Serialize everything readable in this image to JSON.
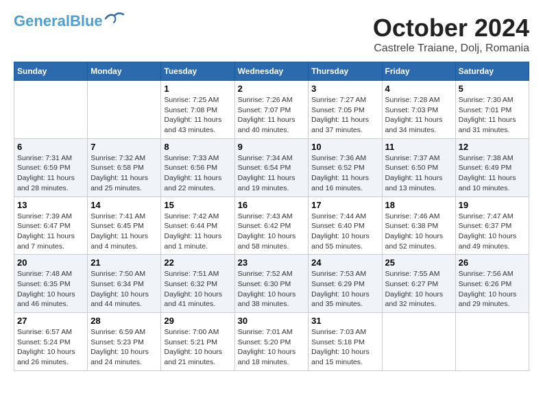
{
  "header": {
    "logo_line1": "General",
    "logo_line2": "Blue",
    "month": "October 2024",
    "location": "Castrele Traiane, Dolj, Romania"
  },
  "weekdays": [
    "Sunday",
    "Monday",
    "Tuesday",
    "Wednesday",
    "Thursday",
    "Friday",
    "Saturday"
  ],
  "weeks": [
    [
      {
        "day": "",
        "sunrise": "",
        "sunset": "",
        "daylight": ""
      },
      {
        "day": "",
        "sunrise": "",
        "sunset": "",
        "daylight": ""
      },
      {
        "day": "1",
        "sunrise": "Sunrise: 7:25 AM",
        "sunset": "Sunset: 7:08 PM",
        "daylight": "Daylight: 11 hours and 43 minutes."
      },
      {
        "day": "2",
        "sunrise": "Sunrise: 7:26 AM",
        "sunset": "Sunset: 7:07 PM",
        "daylight": "Daylight: 11 hours and 40 minutes."
      },
      {
        "day": "3",
        "sunrise": "Sunrise: 7:27 AM",
        "sunset": "Sunset: 7:05 PM",
        "daylight": "Daylight: 11 hours and 37 minutes."
      },
      {
        "day": "4",
        "sunrise": "Sunrise: 7:28 AM",
        "sunset": "Sunset: 7:03 PM",
        "daylight": "Daylight: 11 hours and 34 minutes."
      },
      {
        "day": "5",
        "sunrise": "Sunrise: 7:30 AM",
        "sunset": "Sunset: 7:01 PM",
        "daylight": "Daylight: 11 hours and 31 minutes."
      }
    ],
    [
      {
        "day": "6",
        "sunrise": "Sunrise: 7:31 AM",
        "sunset": "Sunset: 6:59 PM",
        "daylight": "Daylight: 11 hours and 28 minutes."
      },
      {
        "day": "7",
        "sunrise": "Sunrise: 7:32 AM",
        "sunset": "Sunset: 6:58 PM",
        "daylight": "Daylight: 11 hours and 25 minutes."
      },
      {
        "day": "8",
        "sunrise": "Sunrise: 7:33 AM",
        "sunset": "Sunset: 6:56 PM",
        "daylight": "Daylight: 11 hours and 22 minutes."
      },
      {
        "day": "9",
        "sunrise": "Sunrise: 7:34 AM",
        "sunset": "Sunset: 6:54 PM",
        "daylight": "Daylight: 11 hours and 19 minutes."
      },
      {
        "day": "10",
        "sunrise": "Sunrise: 7:36 AM",
        "sunset": "Sunset: 6:52 PM",
        "daylight": "Daylight: 11 hours and 16 minutes."
      },
      {
        "day": "11",
        "sunrise": "Sunrise: 7:37 AM",
        "sunset": "Sunset: 6:50 PM",
        "daylight": "Daylight: 11 hours and 13 minutes."
      },
      {
        "day": "12",
        "sunrise": "Sunrise: 7:38 AM",
        "sunset": "Sunset: 6:49 PM",
        "daylight": "Daylight: 11 hours and 10 minutes."
      }
    ],
    [
      {
        "day": "13",
        "sunrise": "Sunrise: 7:39 AM",
        "sunset": "Sunset: 6:47 PM",
        "daylight": "Daylight: 11 hours and 7 minutes."
      },
      {
        "day": "14",
        "sunrise": "Sunrise: 7:41 AM",
        "sunset": "Sunset: 6:45 PM",
        "daylight": "Daylight: 11 hours and 4 minutes."
      },
      {
        "day": "15",
        "sunrise": "Sunrise: 7:42 AM",
        "sunset": "Sunset: 6:44 PM",
        "daylight": "Daylight: 11 hours and 1 minute."
      },
      {
        "day": "16",
        "sunrise": "Sunrise: 7:43 AM",
        "sunset": "Sunset: 6:42 PM",
        "daylight": "Daylight: 10 hours and 58 minutes."
      },
      {
        "day": "17",
        "sunrise": "Sunrise: 7:44 AM",
        "sunset": "Sunset: 6:40 PM",
        "daylight": "Daylight: 10 hours and 55 minutes."
      },
      {
        "day": "18",
        "sunrise": "Sunrise: 7:46 AM",
        "sunset": "Sunset: 6:38 PM",
        "daylight": "Daylight: 10 hours and 52 minutes."
      },
      {
        "day": "19",
        "sunrise": "Sunrise: 7:47 AM",
        "sunset": "Sunset: 6:37 PM",
        "daylight": "Daylight: 10 hours and 49 minutes."
      }
    ],
    [
      {
        "day": "20",
        "sunrise": "Sunrise: 7:48 AM",
        "sunset": "Sunset: 6:35 PM",
        "daylight": "Daylight: 10 hours and 46 minutes."
      },
      {
        "day": "21",
        "sunrise": "Sunrise: 7:50 AM",
        "sunset": "Sunset: 6:34 PM",
        "daylight": "Daylight: 10 hours and 44 minutes."
      },
      {
        "day": "22",
        "sunrise": "Sunrise: 7:51 AM",
        "sunset": "Sunset: 6:32 PM",
        "daylight": "Daylight: 10 hours and 41 minutes."
      },
      {
        "day": "23",
        "sunrise": "Sunrise: 7:52 AM",
        "sunset": "Sunset: 6:30 PM",
        "daylight": "Daylight: 10 hours and 38 minutes."
      },
      {
        "day": "24",
        "sunrise": "Sunrise: 7:53 AM",
        "sunset": "Sunset: 6:29 PM",
        "daylight": "Daylight: 10 hours and 35 minutes."
      },
      {
        "day": "25",
        "sunrise": "Sunrise: 7:55 AM",
        "sunset": "Sunset: 6:27 PM",
        "daylight": "Daylight: 10 hours and 32 minutes."
      },
      {
        "day": "26",
        "sunrise": "Sunrise: 7:56 AM",
        "sunset": "Sunset: 6:26 PM",
        "daylight": "Daylight: 10 hours and 29 minutes."
      }
    ],
    [
      {
        "day": "27",
        "sunrise": "Sunrise: 6:57 AM",
        "sunset": "Sunset: 5:24 PM",
        "daylight": "Daylight: 10 hours and 26 minutes."
      },
      {
        "day": "28",
        "sunrise": "Sunrise: 6:59 AM",
        "sunset": "Sunset: 5:23 PM",
        "daylight": "Daylight: 10 hours and 24 minutes."
      },
      {
        "day": "29",
        "sunrise": "Sunrise: 7:00 AM",
        "sunset": "Sunset: 5:21 PM",
        "daylight": "Daylight: 10 hours and 21 minutes."
      },
      {
        "day": "30",
        "sunrise": "Sunrise: 7:01 AM",
        "sunset": "Sunset: 5:20 PM",
        "daylight": "Daylight: 10 hours and 18 minutes."
      },
      {
        "day": "31",
        "sunrise": "Sunrise: 7:03 AM",
        "sunset": "Sunset: 5:18 PM",
        "daylight": "Daylight: 10 hours and 15 minutes."
      },
      {
        "day": "",
        "sunrise": "",
        "sunset": "",
        "daylight": ""
      },
      {
        "day": "",
        "sunrise": "",
        "sunset": "",
        "daylight": ""
      }
    ]
  ]
}
